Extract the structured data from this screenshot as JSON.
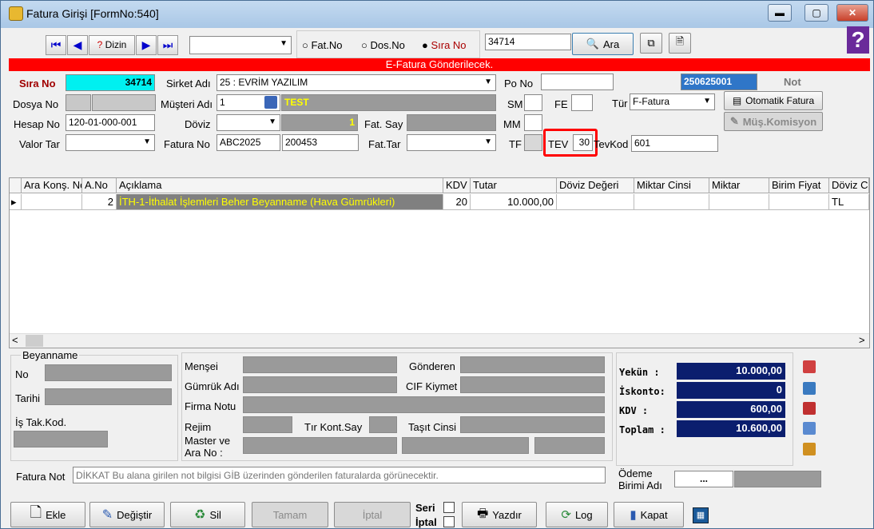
{
  "window": {
    "title": "Fatura Girişi [FormNo:540]"
  },
  "toolbar": {
    "dizin": "Dizin",
    "search_mode": [
      "Fat.No",
      "Dos.No",
      "Sıra No"
    ],
    "selected_mode": "Sıra No",
    "search_value": "34714",
    "ara": "Ara"
  },
  "banner": "E-Fatura Gönderilecek.",
  "header": {
    "sira_no_label": "Sıra No",
    "sira_no": "34714",
    "sirket_label": "Sirket Adı",
    "sirket": "25 : EVRİM YAZILIM",
    "po_label": "Po No",
    "po": "",
    "ref_code": "250625001",
    "not_label": "Not",
    "dosya_label": "Dosya No",
    "musteri_label": "Müşteri Adı",
    "musteri_code": "1",
    "musteri_name": "TEST",
    "sm_label": "SM",
    "fe_label": "FE",
    "tur_label": "Tür",
    "tur": "F-Fatura",
    "otomatik": "Otomatik Fatura",
    "hesap_label": "Hesap No",
    "hesap": "120-01-000-001",
    "doviz_label": "Döviz",
    "doviz_val": "1",
    "fatsay_label": "Fat. Say",
    "mm_label": "MM",
    "mus_komisyon": "Müş.Komisyon",
    "valor_label": "Valor Tar",
    "fatno_label": "Fatura No",
    "fatno1": "ABC2025",
    "fatno2": "200453",
    "fattar_label": "Fat.Tar",
    "tf_label": "TF",
    "tev_label": "TEV",
    "tev": "30",
    "tevkod_label": "TevKod",
    "tevkod": "601"
  },
  "grid": {
    "headers": [
      "Ara Konş. No",
      "A.No",
      "Açıklama",
      "KDV",
      "Tutar",
      "Döviz Değeri",
      "Miktar Cinsi",
      "Miktar",
      "Birim Fiyat",
      "Döviz Ci"
    ],
    "row": {
      "ano": "2",
      "aciklama": "İTH-1-İthalat İşlemleri Beher Beyanname (Hava Gümrükleri)",
      "kdv": "20",
      "tutar": "10.000,00",
      "doviz": "TL"
    }
  },
  "beyanname": {
    "title": "Beyanname",
    "no": "No",
    "tarihi": "Tarihi",
    "is_tak": "İş Tak.Kod."
  },
  "details": {
    "mensei": "Menşei",
    "gonderen": "Gönderen",
    "gumruk": "Gümrük Adı",
    "cif": "CIF Kiymet",
    "firma_notu": "Firma Notu",
    "rejim": "Rejim",
    "tir": "Tır Kont.Say",
    "tasit": "Taşıt Cinsi",
    "master": "Master ve Ara No :"
  },
  "totals": {
    "yekun_l": "Yekün  :",
    "yekun": "10.000,00",
    "iskonto_l": "İskonto:",
    "iskonto": "0",
    "kdv_l": "KDV    :",
    "kdv": "600,00",
    "toplam_l": "Toplam :",
    "toplam": "10.600,00"
  },
  "fatura_not": {
    "label": "Fatura Not",
    "placeholder": "DİKKAT Bu alana girilen not bilgisi GİB üzerinden gönderilen faturalarda görünecektir."
  },
  "odeme": {
    "label": "Ödeme Birimi Adı",
    "btn": "..."
  },
  "buttons": {
    "ekle": "Ekle",
    "degistir": "Değiştir",
    "sil": "Sil",
    "tamam": "Tamam",
    "iptal": "İptal",
    "seri": "Seri",
    "iptal2": "İptal",
    "yazdir": "Yazdır",
    "log": "Log",
    "kapat": "Kapat"
  }
}
